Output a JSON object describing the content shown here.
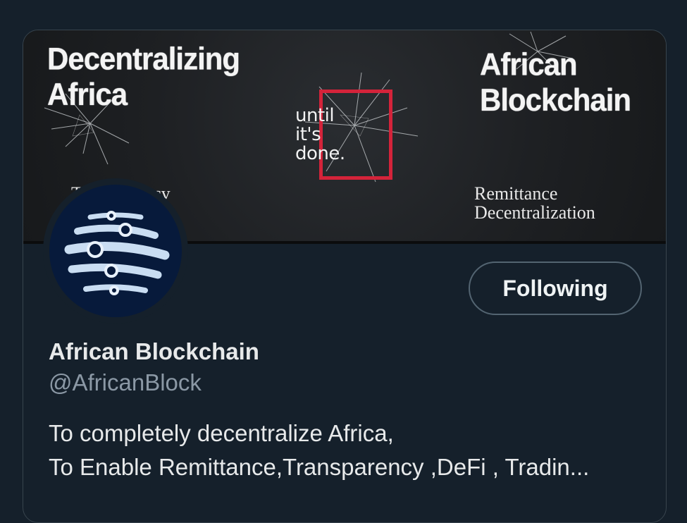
{
  "profile_card": {
    "banner": {
      "left_title_line1": "Decentralizing",
      "left_title_line2": "Africa",
      "left_subtitle_line1": "Transparency",
      "left_subtitle_line2": "",
      "center_line1": "until",
      "center_line2": "it's",
      "center_line3": "done.",
      "right_title_line1": "African",
      "right_title_line2": "Blockchain",
      "right_subtitle_line1": "Remittance",
      "right_subtitle_line2": "Decentralization",
      "accent_color": "#d4233a"
    },
    "avatar": {
      "icon": "globe-network-logo-icon"
    },
    "follow_button_label": "Following",
    "display_name": "African Blockchain",
    "handle": "@AfricanBlock",
    "bio_line1": "To completely decentralize Africa,",
    "bio_line2": "To Enable Remittance,Transparency ,DeFi , Tradin..."
  }
}
